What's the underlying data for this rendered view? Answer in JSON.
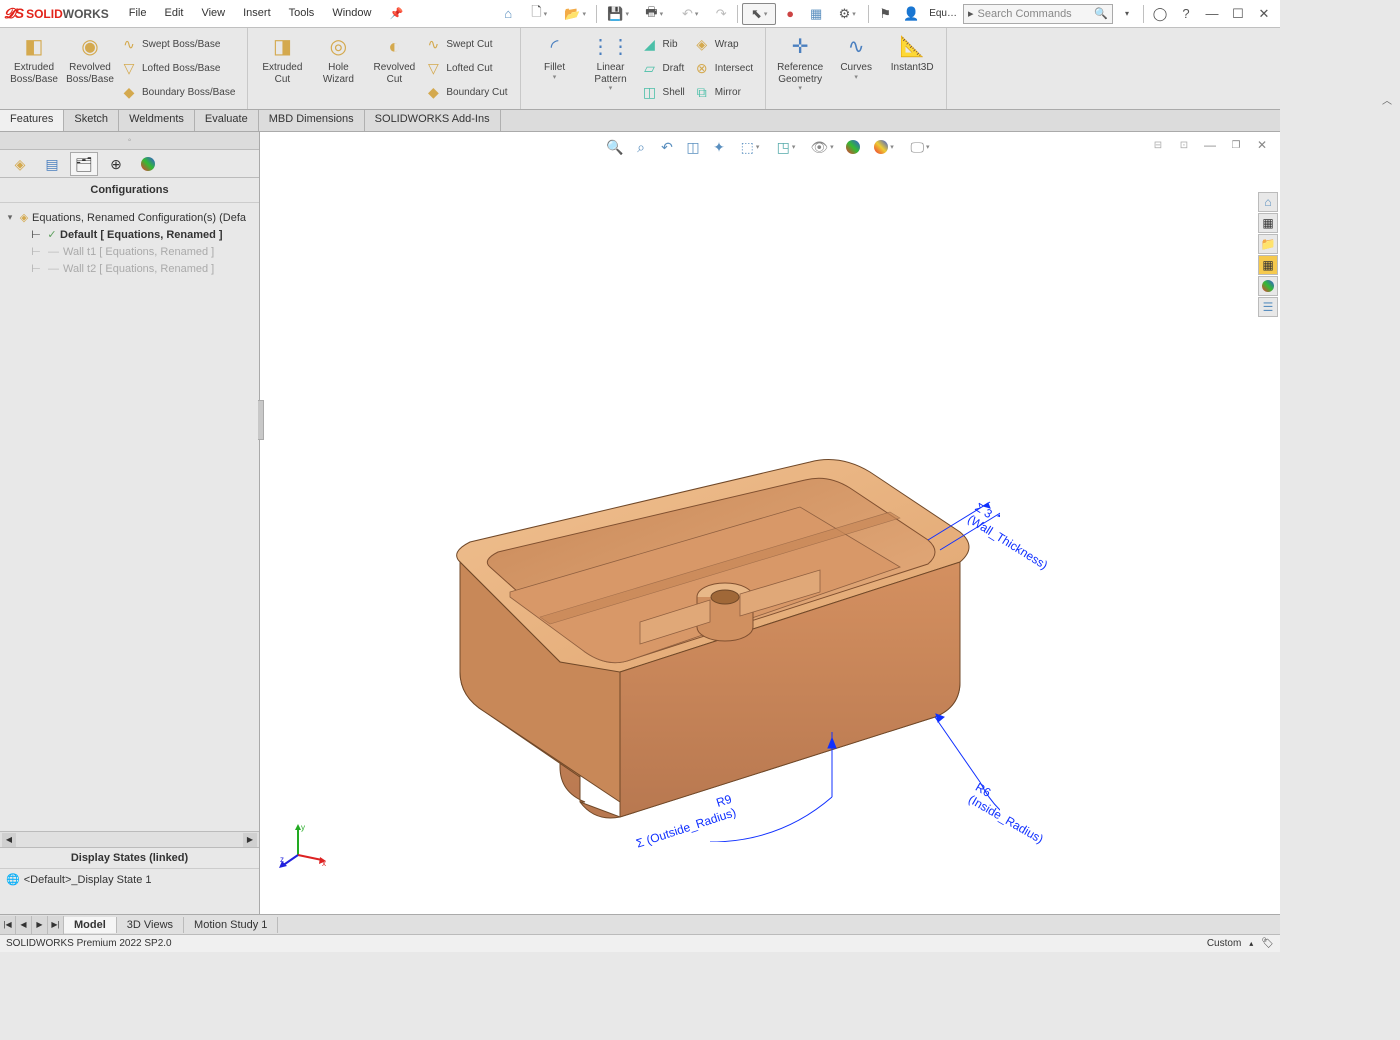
{
  "app": {
    "name1": "SOLID",
    "name2": "WORKS"
  },
  "menu": [
    "File",
    "Edit",
    "View",
    "Insert",
    "Tools",
    "Window"
  ],
  "search_label": "Equ…",
  "search_placeholder": "Search Commands",
  "ribbon": {
    "g1": {
      "extruded": "Extruded Boss/Base",
      "revolved": "Revolved Boss/Base",
      "swept": "Swept Boss/Base",
      "lofted": "Lofted Boss/Base",
      "boundary": "Boundary Boss/Base"
    },
    "g2": {
      "extcut": "Extruded Cut",
      "hole": "Hole Wizard",
      "revcut": "Revolved Cut",
      "sweptcut": "Swept Cut",
      "loftedcut": "Lofted Cut",
      "boundarycut": "Boundary Cut"
    },
    "g3": {
      "fillet": "Fillet",
      "linear": "Linear Pattern",
      "rib": "Rib",
      "draft": "Draft",
      "shell": "Shell",
      "wrap": "Wrap",
      "intersect": "Intersect",
      "mirror": "Mirror"
    },
    "g4": {
      "refgeo": "Reference Geometry",
      "curves": "Curves",
      "instant": "Instant3D"
    }
  },
  "cmd_tabs": [
    "Features",
    "Sketch",
    "Weldments",
    "Evaluate",
    "MBD Dimensions",
    "SOLIDWORKS Add-Ins"
  ],
  "panel": {
    "header": "Configurations",
    "root": "Equations, Renamed Configuration(s)  (Defa",
    "item1": "Default [ Equations, Renamed ]",
    "item2": "Wall t1 [ Equations, Renamed ]",
    "item3": "Wall t2 [ Equations, Renamed ]",
    "display_header": "Display States (linked)",
    "display_item": "<Default>_Display State 1"
  },
  "dims": {
    "wall_sym": "Σ  3",
    "wall_name": "(Wall_Thickness)",
    "o_rad": "R9",
    "o_name": "Σ (Outside_Radius)",
    "i_rad": "R6",
    "i_name": "(Inside_Radius)"
  },
  "mtabs": [
    "Model",
    "3D Views",
    "Motion Study 1"
  ],
  "status": {
    "left": "SOLIDWORKS Premium 2022 SP2.0",
    "right": "Custom"
  },
  "triad_labels": {
    "x": "x",
    "y": "y",
    "z": "z"
  }
}
